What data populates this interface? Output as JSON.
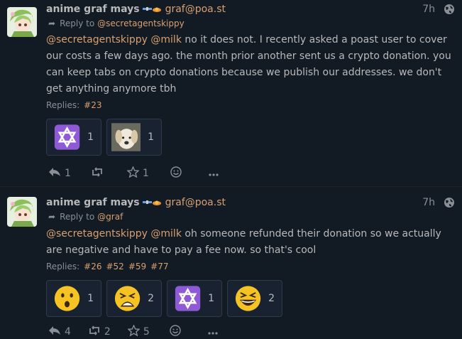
{
  "colors": {
    "accent": "#d8a070",
    "text": "#b9b9ba",
    "bg": "#121a24",
    "muted": "#8a8f96"
  },
  "statuses": [
    {
      "author_name": "anime graf mays",
      "author_handle": "graf@poa.st",
      "time": "7h",
      "reply_to_label": "Reply to",
      "reply_to": "@secretagentskippy",
      "content_mentions": "@secretagentskippy @milk",
      "content_text": " no it does not. I recently asked a poast user to cover our costs a few days ago. the month prior another sent us a crypto donation. you can keep tabs on crypto donations because we publish our addresses. we don't get anything anymore tbh",
      "replies_label": "Replies:",
      "replies": [
        "#23"
      ],
      "reactions": [
        {
          "emoji": "star-of-david-emoji",
          "count": "1"
        },
        {
          "emoji": "dog-emoji",
          "count": "1"
        }
      ],
      "reply_count": "1",
      "repeat_count": "",
      "favorite_count": "1"
    },
    {
      "author_name": "anime graf mays",
      "author_handle": "graf@poa.st",
      "time": "7h",
      "reply_to_label": "Reply to",
      "reply_to": "@graf",
      "content_mentions": "@secretagentskippy @milk",
      "content_text": " oh someone refunded their donation so we actually are negative and have to pay a fee now. so that's cool",
      "replies_label": "Replies:",
      "replies": [
        "#26",
        "#52",
        "#59",
        "#77"
      ],
      "reactions": [
        {
          "emoji": "hushed-face-emoji",
          "count": "1"
        },
        {
          "emoji": "weary-face-emoji",
          "count": "2"
        },
        {
          "emoji": "star-of-david-emoji",
          "count": "1"
        },
        {
          "emoji": "laughing-face-emoji",
          "count": "2"
        }
      ],
      "reply_count": "4",
      "repeat_count": "2",
      "favorite_count": "5"
    }
  ]
}
